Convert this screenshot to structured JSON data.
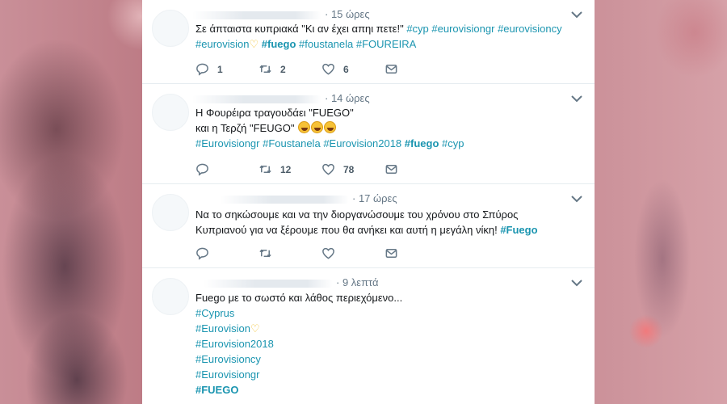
{
  "tweets": [
    {
      "time": "· 15 ώρες",
      "lines": [
        [
          {
            "t": "Σε άπταιστα κυπριακά \"Κι αν έχει απηι πετε!\" "
          },
          {
            "t": "#cyp",
            "tag": true
          },
          {
            "t": " "
          },
          {
            "t": "#eurovisiongr",
            "tag": true
          },
          {
            "t": " "
          },
          {
            "t": "#eurovisioncy",
            "tag": true
          }
        ],
        [
          {
            "t": "#eurovision",
            "tag": true
          },
          {
            "t": "♡",
            "heart": true
          },
          {
            "t": " "
          },
          {
            "t": "#fuego",
            "tag": true,
            "bold": true
          },
          {
            "t": " "
          },
          {
            "t": "#foustanela",
            "tag": true
          },
          {
            "t": " "
          },
          {
            "t": "#FOUREIRA",
            "tag": true
          }
        ]
      ],
      "reply_count": "1",
      "retweet_count": "2",
      "like_count": "6"
    },
    {
      "time": "· 14 ώρες",
      "lines": [
        [
          {
            "t": "Η Φουρέιρα τραγουδάει \"FUEGO\""
          }
        ],
        [
          {
            "t": "και η Τερζή \"FEUGO\" "
          },
          {
            "laugh": 3
          }
        ],
        [
          {
            "t": "#Eurovisiongr",
            "tag": true
          },
          {
            "t": " "
          },
          {
            "t": "#Foustanela",
            "tag": true
          },
          {
            "t": " "
          },
          {
            "t": "#Eurovision2018",
            "tag": true
          },
          {
            "t": " "
          },
          {
            "t": "#fuego",
            "tag": true,
            "bold": true
          },
          {
            "t": " "
          },
          {
            "t": "#cyp",
            "tag": true
          }
        ]
      ],
      "reply_count": "",
      "retweet_count": "12",
      "like_count": "78"
    },
    {
      "time": "· 17 ώρες",
      "lines": [
        [
          {
            "t": "Να το σηκώσουμε και να την διοργανώσουμε του χρόνου στο Σπύρος"
          }
        ],
        [
          {
            "t": "Κυπριανού για να ξέρουμε που θα ανήκει και αυτή η μεγάλη νίκη! "
          },
          {
            "t": "#Fuego",
            "tag": true,
            "bold": true
          }
        ]
      ],
      "reply_count": "",
      "retweet_count": "",
      "like_count": ""
    },
    {
      "time": "· 9 λεπτά",
      "lines": [
        [
          {
            "t": "Fuego με το σωστό και λάθος περιεχόμενο..."
          }
        ],
        [
          {
            "t": "#Cyprus",
            "tag": true
          }
        ],
        [
          {
            "t": "#Eurovision",
            "tag": true
          },
          {
            "t": "♡",
            "heart": true
          }
        ],
        [
          {
            "t": "#Eurovision2018",
            "tag": true
          }
        ],
        [
          {
            "t": "#Eurovisioncy",
            "tag": true
          }
        ],
        [
          {
            "t": "#Eurovisiongr",
            "tag": true
          }
        ],
        [
          {
            "t": "#FUEGO",
            "tag": true,
            "bold": true
          }
        ]
      ]
    }
  ],
  "icons": {
    "reply": "reply-icon",
    "retweet": "retweet-icon",
    "like": "heart-icon",
    "dm": "envelope-icon",
    "more": "chevron-down-icon"
  },
  "colors": {
    "hashtag": "#1b95b0",
    "text": "#14171a",
    "muted": "#657786"
  }
}
